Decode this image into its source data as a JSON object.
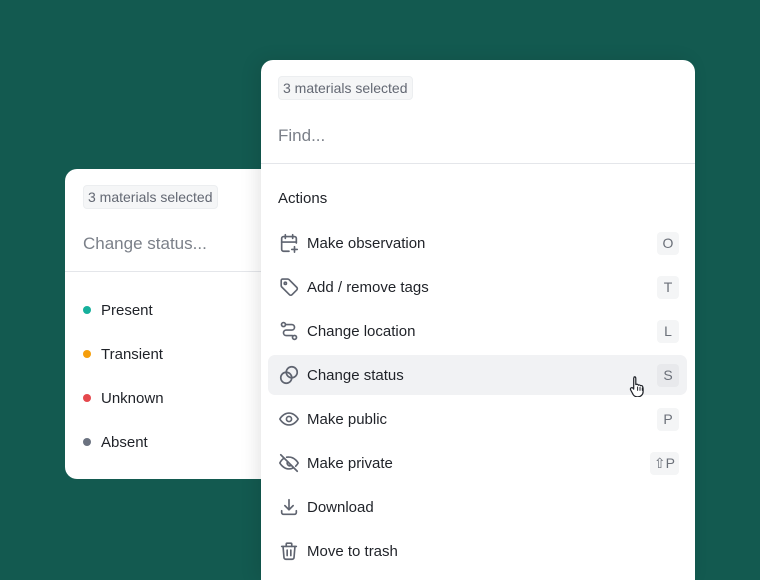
{
  "background_color": "#135a50",
  "status_panel": {
    "selection_chip": "3 materials selected",
    "search_placeholder": "Change status...",
    "items": [
      {
        "label": "Present",
        "color": "#16b09c"
      },
      {
        "label": "Transient",
        "color": "#f59e0b"
      },
      {
        "label": "Unknown",
        "color": "#e5484d"
      },
      {
        "label": "Absent",
        "color": "#6b7280"
      }
    ]
  },
  "actions_panel": {
    "selection_chip": "3 materials selected",
    "search_placeholder": "Find...",
    "section_title": "Actions",
    "items": [
      {
        "label": "Make observation",
        "shortcut": "O",
        "icon": "calendar-plus-icon"
      },
      {
        "label": "Add / remove tags",
        "shortcut": "T",
        "icon": "tag-icon"
      },
      {
        "label": "Change location",
        "shortcut": "L",
        "icon": "route-icon"
      },
      {
        "label": "Change status",
        "shortcut": "S",
        "icon": "status-circles-icon"
      },
      {
        "label": "Make public",
        "shortcut": "P",
        "icon": "eye-icon"
      },
      {
        "label": "Make private",
        "shortcut": "⇧P",
        "icon": "eye-off-icon"
      },
      {
        "label": "Download",
        "shortcut": "",
        "icon": "download-icon"
      },
      {
        "label": "Move to trash",
        "shortcut": "",
        "icon": "trash-icon"
      }
    ],
    "highlighted_item": "Change status"
  }
}
